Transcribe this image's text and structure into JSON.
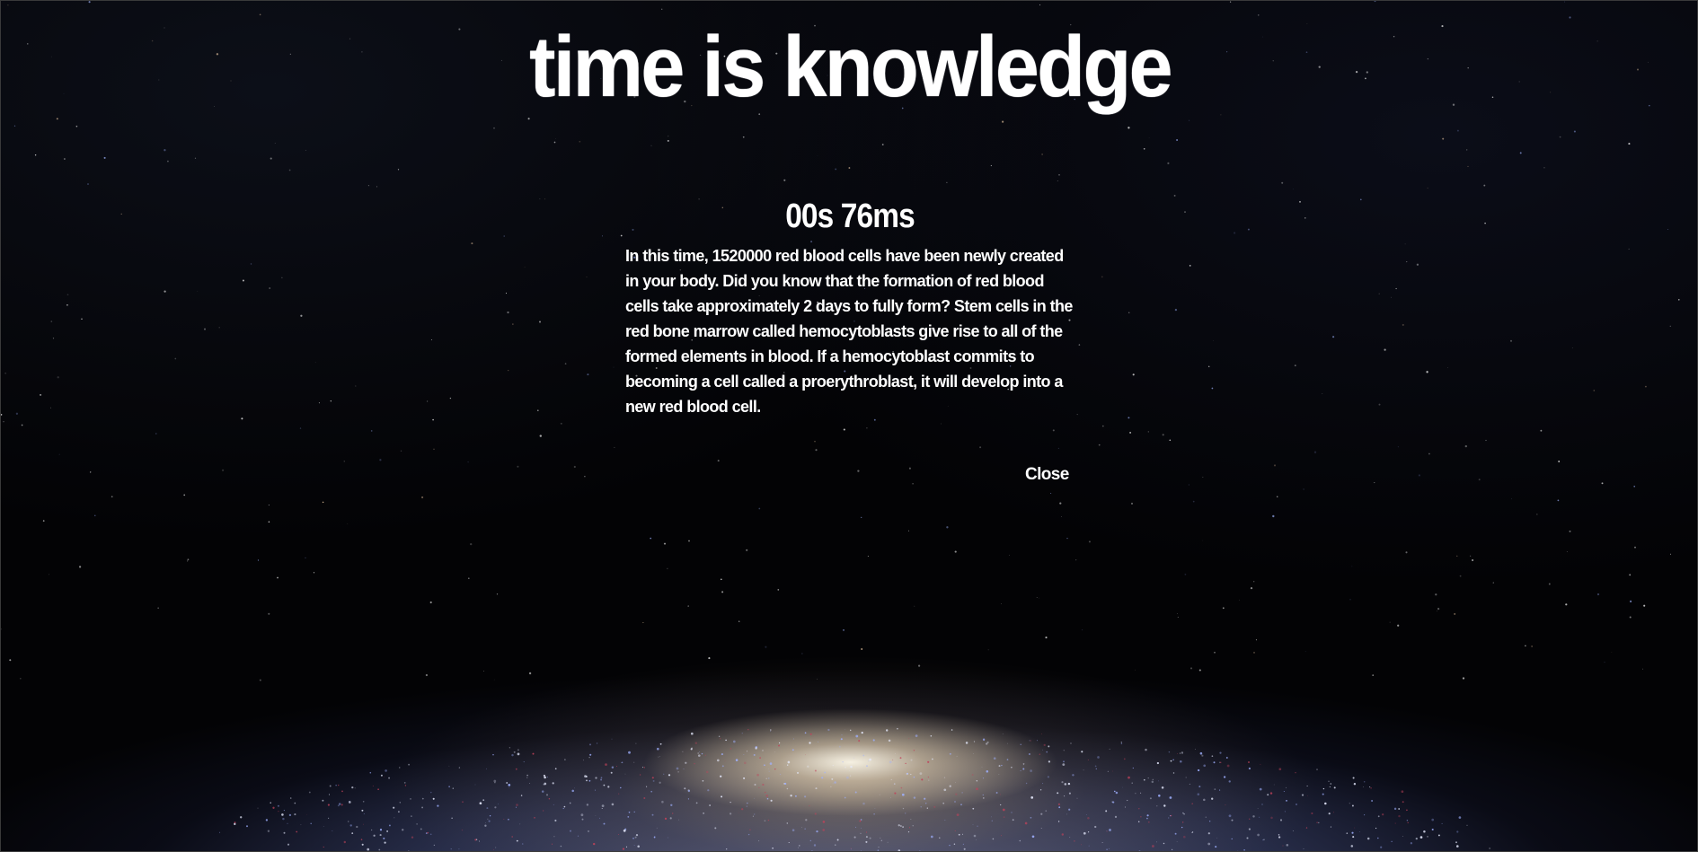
{
  "header": {
    "title": "time is knowledge"
  },
  "modal": {
    "timer": "00s 76ms",
    "fact_text": "In this time, 1520000 red blood cells have been newly created in your body. Did you know that the formation of red blood cells take approximately 2 days to fully form? Stem cells in the red bone marrow called hemocytoblasts give rise to all of the formed elements in blood. If a hemocytoblast commits to becoming a cell called a proerythroblast, it will develop into a new red blood cell.",
    "close_label": "Close"
  },
  "colors": {
    "background": "#030305",
    "text": "#ffffff",
    "galaxy_glow": "#fff4dc",
    "galaxy_arm": "#6e78aa"
  }
}
